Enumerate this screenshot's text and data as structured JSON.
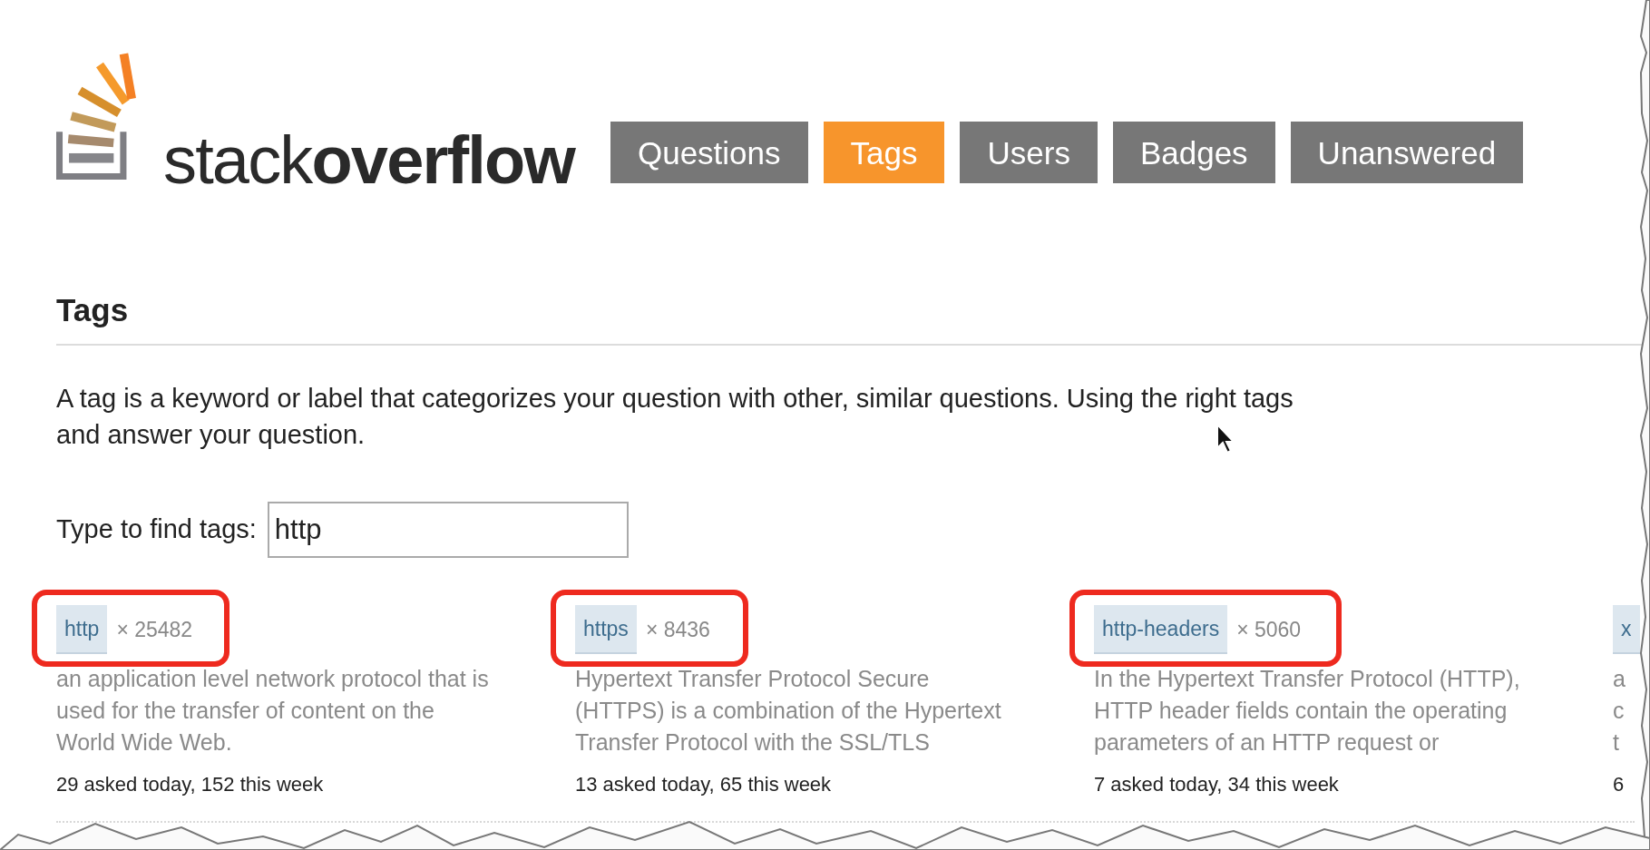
{
  "logo": {
    "text": "stack**overflow**"
  },
  "nav": [
    {
      "label": "Questions",
      "selected": false
    },
    {
      "label": "Tags",
      "selected": true
    },
    {
      "label": "Users",
      "selected": false
    },
    {
      "label": "Badges",
      "selected": false
    },
    {
      "label": "Unanswered",
      "selected": false
    }
  ],
  "heading": "Tags",
  "intro_lines": [
    "A tag is a keyword or label that categorizes your question with other, similar questions. Using the right tags",
    "and answer your question."
  ],
  "search": {
    "label": "Type to find tags:",
    "value": "http"
  },
  "tags": [
    {
      "name": "http",
      "count": "× 25482",
      "highlighted": true,
      "description": [
        "an application level network protocol that is",
        "used for the transfer of content on the",
        "World Wide Web."
      ],
      "stats": "29 asked today, 152 this week"
    },
    {
      "name": "https",
      "count": "× 8436",
      "highlighted": true,
      "description": [
        "Hypertext Transfer Protocol Secure",
        "(HTTPS) is a combination of the Hypertext",
        "Transfer Protocol with the SSL/TLS"
      ],
      "stats": "13 asked today, 65 this week"
    },
    {
      "name": "http-headers",
      "count": "× 5060",
      "highlighted": true,
      "description": [
        "In the Hypertext Transfer Protocol (HTTP),",
        "HTTP header fields contain the operating",
        "parameters of an HTTP request or"
      ],
      "stats": "7 asked today, 34 this week"
    },
    {
      "name": "x",
      "highlighted": false,
      "description": [
        "a",
        "c",
        "t"
      ],
      "stats": "6"
    }
  ]
}
